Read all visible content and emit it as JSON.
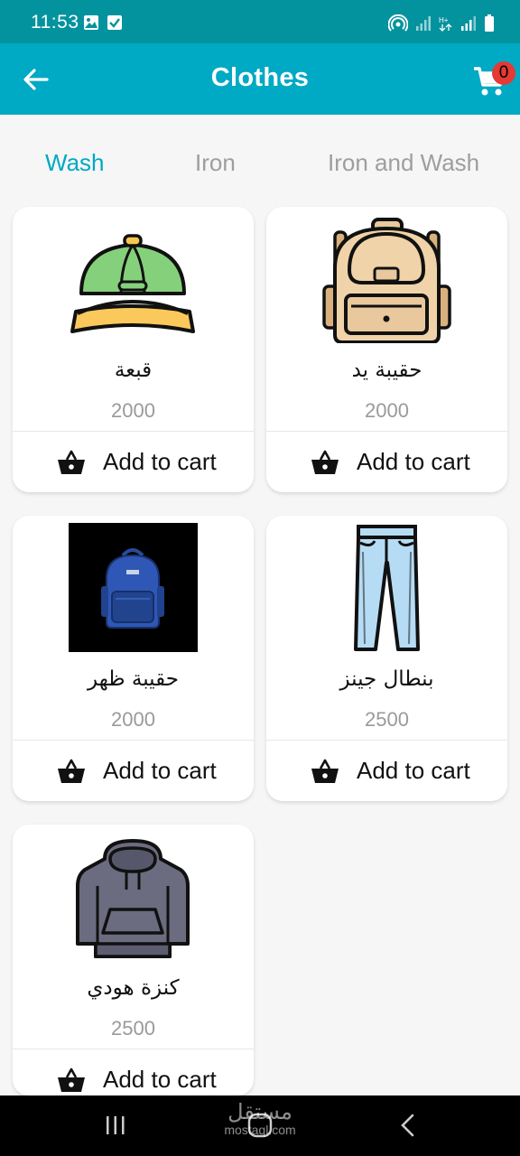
{
  "status_bar": {
    "time": "11:53"
  },
  "header": {
    "title": "Clothes",
    "cart_count": "0"
  },
  "tabs": [
    {
      "label": "Wash",
      "active": true
    },
    {
      "label": "Iron",
      "active": false
    },
    {
      "label": "Iron and Wash",
      "active": false
    }
  ],
  "products": [
    {
      "name": "قبعة",
      "price": "2000",
      "image": "cap-icon"
    },
    {
      "name": "حقيبة يد",
      "price": "2000",
      "image": "backpack-icon"
    },
    {
      "name": "حقيبة ظهر",
      "price": "2000",
      "image": "blue-backpack-photo"
    },
    {
      "name": "بنطال جينز",
      "price": "2500",
      "image": "jeans-icon"
    },
    {
      "name": "كنزة هودي",
      "price": "2500",
      "image": "hoodie-icon"
    }
  ],
  "add_to_cart_label": "Add to cart",
  "watermark": {
    "arabic": "مستقل",
    "latin": "mostaql.com"
  },
  "colors": {
    "status_bar": "#03939f",
    "app_bar": "#00a9c4",
    "accent": "#00a9c4",
    "badge": "#e53935",
    "background": "#f6f6f6"
  }
}
